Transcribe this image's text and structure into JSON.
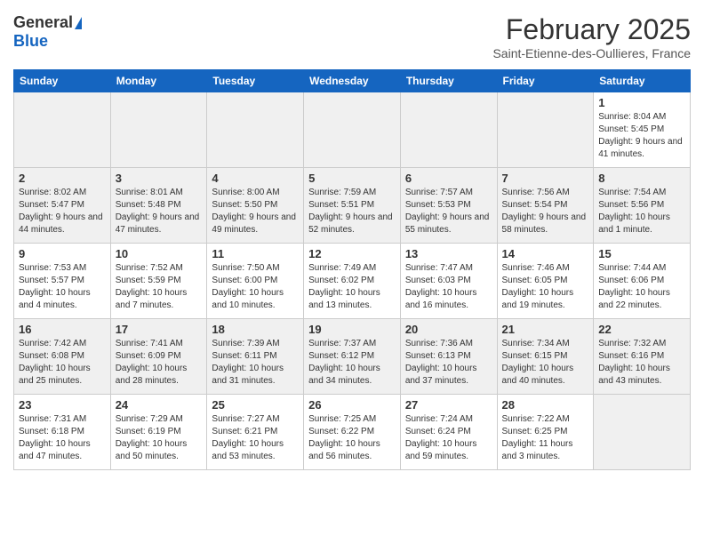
{
  "logo": {
    "general": "General",
    "blue": "Blue"
  },
  "header": {
    "month": "February 2025",
    "location": "Saint-Etienne-des-Oullieres, France"
  },
  "days_of_week": [
    "Sunday",
    "Monday",
    "Tuesday",
    "Wednesday",
    "Thursday",
    "Friday",
    "Saturday"
  ],
  "weeks": [
    [
      {
        "day": "",
        "info": ""
      },
      {
        "day": "",
        "info": ""
      },
      {
        "day": "",
        "info": ""
      },
      {
        "day": "",
        "info": ""
      },
      {
        "day": "",
        "info": ""
      },
      {
        "day": "",
        "info": ""
      },
      {
        "day": "1",
        "info": "Sunrise: 8:04 AM\nSunset: 5:45 PM\nDaylight: 9 hours and 41 minutes."
      }
    ],
    [
      {
        "day": "2",
        "info": "Sunrise: 8:02 AM\nSunset: 5:47 PM\nDaylight: 9 hours and 44 minutes."
      },
      {
        "day": "3",
        "info": "Sunrise: 8:01 AM\nSunset: 5:48 PM\nDaylight: 9 hours and 47 minutes."
      },
      {
        "day": "4",
        "info": "Sunrise: 8:00 AM\nSunset: 5:50 PM\nDaylight: 9 hours and 49 minutes."
      },
      {
        "day": "5",
        "info": "Sunrise: 7:59 AM\nSunset: 5:51 PM\nDaylight: 9 hours and 52 minutes."
      },
      {
        "day": "6",
        "info": "Sunrise: 7:57 AM\nSunset: 5:53 PM\nDaylight: 9 hours and 55 minutes."
      },
      {
        "day": "7",
        "info": "Sunrise: 7:56 AM\nSunset: 5:54 PM\nDaylight: 9 hours and 58 minutes."
      },
      {
        "day": "8",
        "info": "Sunrise: 7:54 AM\nSunset: 5:56 PM\nDaylight: 10 hours and 1 minute."
      }
    ],
    [
      {
        "day": "9",
        "info": "Sunrise: 7:53 AM\nSunset: 5:57 PM\nDaylight: 10 hours and 4 minutes."
      },
      {
        "day": "10",
        "info": "Sunrise: 7:52 AM\nSunset: 5:59 PM\nDaylight: 10 hours and 7 minutes."
      },
      {
        "day": "11",
        "info": "Sunrise: 7:50 AM\nSunset: 6:00 PM\nDaylight: 10 hours and 10 minutes."
      },
      {
        "day": "12",
        "info": "Sunrise: 7:49 AM\nSunset: 6:02 PM\nDaylight: 10 hours and 13 minutes."
      },
      {
        "day": "13",
        "info": "Sunrise: 7:47 AM\nSunset: 6:03 PM\nDaylight: 10 hours and 16 minutes."
      },
      {
        "day": "14",
        "info": "Sunrise: 7:46 AM\nSunset: 6:05 PM\nDaylight: 10 hours and 19 minutes."
      },
      {
        "day": "15",
        "info": "Sunrise: 7:44 AM\nSunset: 6:06 PM\nDaylight: 10 hours and 22 minutes."
      }
    ],
    [
      {
        "day": "16",
        "info": "Sunrise: 7:42 AM\nSunset: 6:08 PM\nDaylight: 10 hours and 25 minutes."
      },
      {
        "day": "17",
        "info": "Sunrise: 7:41 AM\nSunset: 6:09 PM\nDaylight: 10 hours and 28 minutes."
      },
      {
        "day": "18",
        "info": "Sunrise: 7:39 AM\nSunset: 6:11 PM\nDaylight: 10 hours and 31 minutes."
      },
      {
        "day": "19",
        "info": "Sunrise: 7:37 AM\nSunset: 6:12 PM\nDaylight: 10 hours and 34 minutes."
      },
      {
        "day": "20",
        "info": "Sunrise: 7:36 AM\nSunset: 6:13 PM\nDaylight: 10 hours and 37 minutes."
      },
      {
        "day": "21",
        "info": "Sunrise: 7:34 AM\nSunset: 6:15 PM\nDaylight: 10 hours and 40 minutes."
      },
      {
        "day": "22",
        "info": "Sunrise: 7:32 AM\nSunset: 6:16 PM\nDaylight: 10 hours and 43 minutes."
      }
    ],
    [
      {
        "day": "23",
        "info": "Sunrise: 7:31 AM\nSunset: 6:18 PM\nDaylight: 10 hours and 47 minutes."
      },
      {
        "day": "24",
        "info": "Sunrise: 7:29 AM\nSunset: 6:19 PM\nDaylight: 10 hours and 50 minutes."
      },
      {
        "day": "25",
        "info": "Sunrise: 7:27 AM\nSunset: 6:21 PM\nDaylight: 10 hours and 53 minutes."
      },
      {
        "day": "26",
        "info": "Sunrise: 7:25 AM\nSunset: 6:22 PM\nDaylight: 10 hours and 56 minutes."
      },
      {
        "day": "27",
        "info": "Sunrise: 7:24 AM\nSunset: 6:24 PM\nDaylight: 10 hours and 59 minutes."
      },
      {
        "day": "28",
        "info": "Sunrise: 7:22 AM\nSunset: 6:25 PM\nDaylight: 11 hours and 3 minutes."
      },
      {
        "day": "",
        "info": ""
      }
    ]
  ]
}
